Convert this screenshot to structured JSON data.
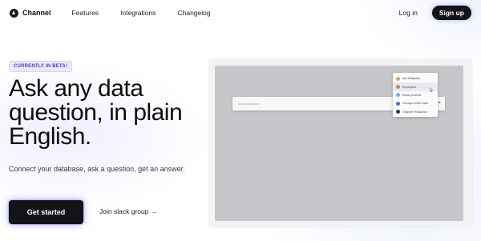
{
  "nav": {
    "brand": "Channel",
    "links": [
      "Features",
      "Integrations",
      "Changelog"
    ],
    "login": "Log in",
    "signup": "Sign up"
  },
  "hero": {
    "badge": "CURRENTLY IN BETA!",
    "headline": "Ask any data question, in plain English.",
    "subtext": "Connect your database, ask a question, get an answer.",
    "cta": "Get started",
    "secondary": "Join slack group →"
  },
  "preview": {
    "query_placeholder": "Ask a question",
    "dropdown": [
      {
        "label": "Ask Wikipedia",
        "color": "#d9a46a"
      },
      {
        "label": "Employees",
        "color": "#b88a62"
      },
      {
        "label": "Retail products",
        "color": "#7ab0d8"
      },
      {
        "label": "Chicago Crime Data",
        "color": "#4a6fd0"
      },
      {
        "label": "Channel Production",
        "color": "#2f3b55"
      }
    ]
  },
  "colors": {
    "accent_glow": "#6e78ff",
    "button_dark": "#141416",
    "badge_bg": "#ece8ff",
    "badge_text": "#4b3fa8"
  }
}
